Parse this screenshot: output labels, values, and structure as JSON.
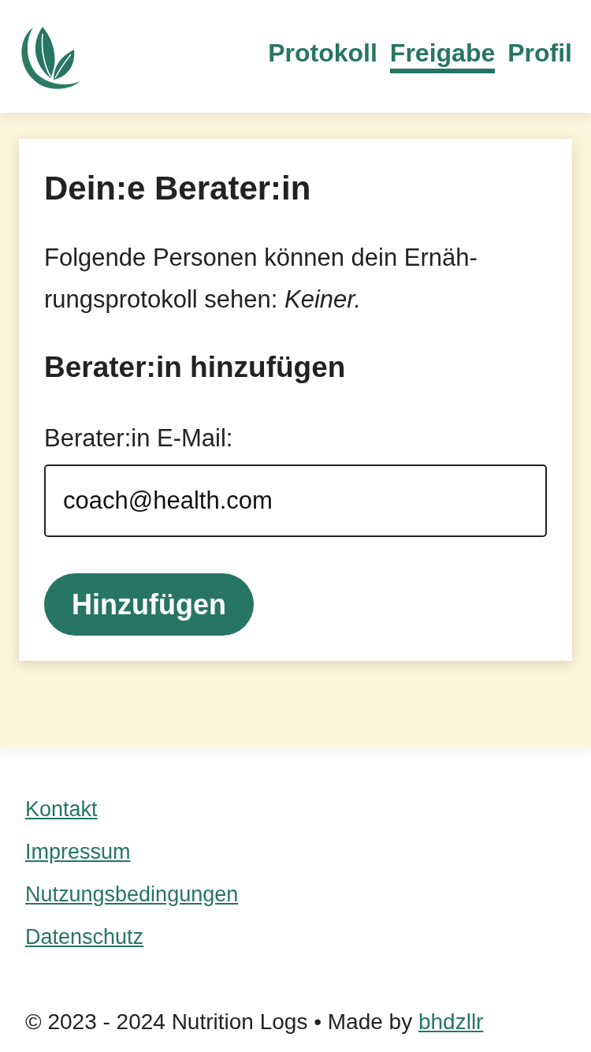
{
  "header": {
    "nav": [
      {
        "label": "Protokoll",
        "selected": false
      },
      {
        "label": "Freigabe",
        "selected": true
      },
      {
        "label": "Profil",
        "selected": false
      }
    ]
  },
  "card": {
    "title": "Dein:e Berater:in",
    "text": "Folgende Personen können dein Ernäh-rungsprotokoll sehen: *Keiner.*",
    "subtitle": "Berater:in hinzufügen",
    "email_field": {
      "label": "Berater:in E-Mail:",
      "value": "coach@health.com"
    },
    "button": "Hinzufügen"
  },
  "footer": {
    "links": [
      "Kontakt",
      "Impressum",
      "Nutzungsbedingungen",
      "Datenschutz"
    ],
    "copyright": "© 2023 - 2024 Nutrition Logs • Made by",
    "author_link": "bhdzllr"
  }
}
